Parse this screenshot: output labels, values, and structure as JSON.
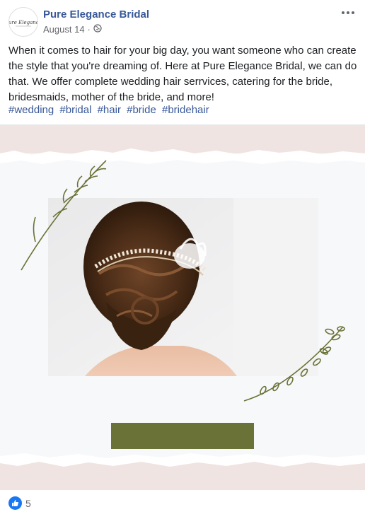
{
  "post": {
    "page_name": "Pure Elegance Bridal",
    "avatar_text": "Pure Elegance",
    "date": "August 14",
    "separator": "·",
    "body": "When it comes to hair for your big day, you want someone who can create the style that you're dreaming of. Here at Pure Elegance Bridal, we can do that. We offer complete wedding hair serrvices, catering for the bride, bridesmaids, mother of the bride, and more!",
    "hashtags": [
      "#wedding",
      "#bridal",
      "#hair",
      "#bride",
      "#bridehair"
    ]
  },
  "reactions": {
    "count": "5"
  },
  "colors": {
    "link": "#385898",
    "accent_green": "#6b7237",
    "like_blue": "#1877f2",
    "torn_band": "#f0e4e2"
  },
  "icons": {
    "privacy": "globe-icon",
    "more": "more-options-icon",
    "like": "like-icon"
  }
}
